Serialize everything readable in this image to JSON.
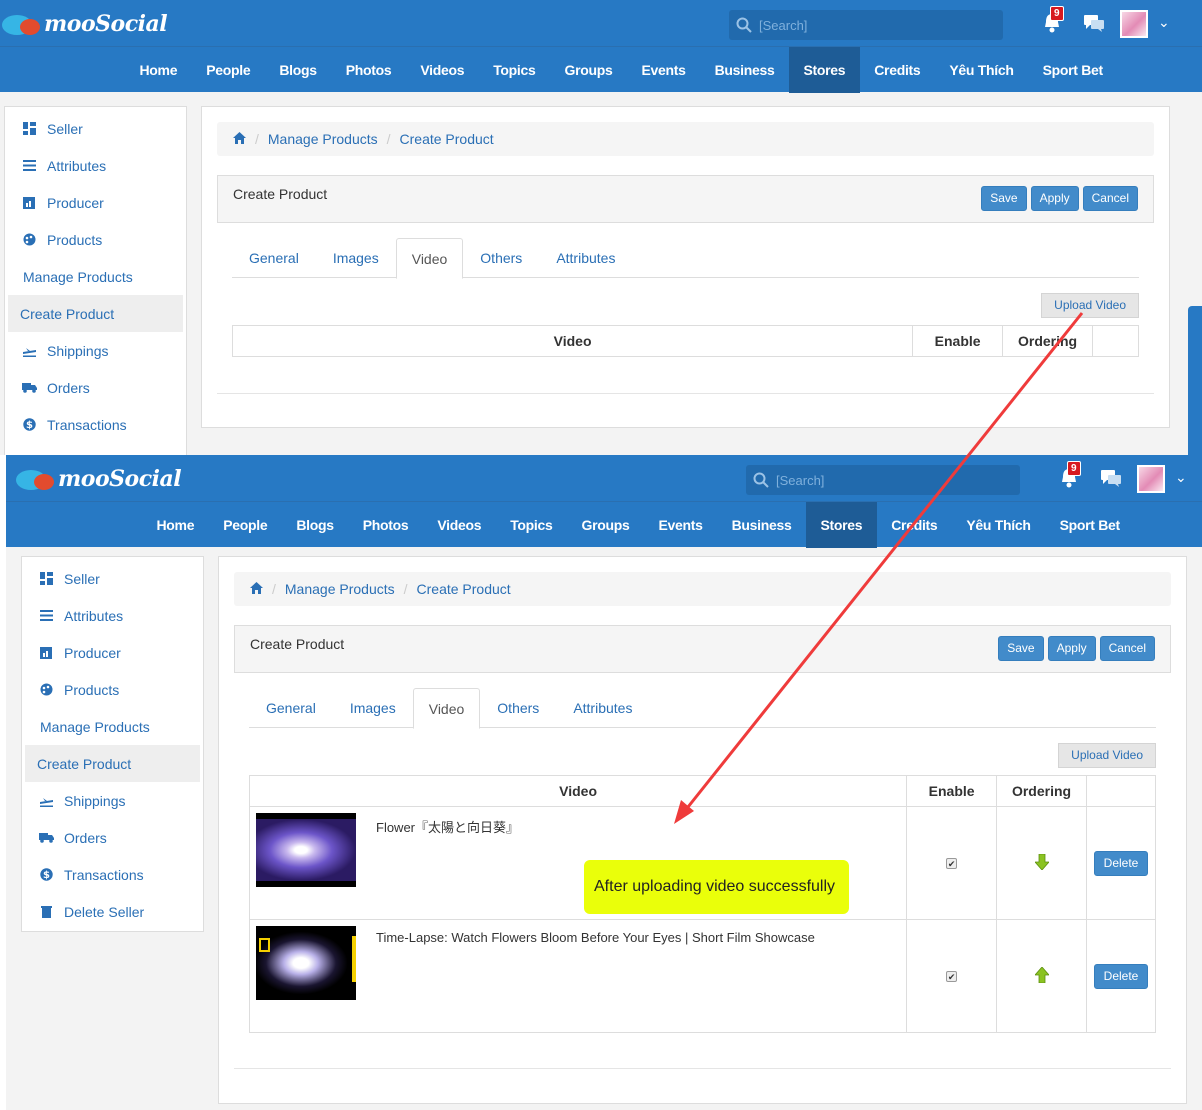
{
  "app": {
    "logo_text": "mooSocial",
    "search_placeholder": "[Search]",
    "notification_count": "9"
  },
  "nav": [
    "Home",
    "People",
    "Blogs",
    "Photos",
    "Videos",
    "Topics",
    "Groups",
    "Events",
    "Business",
    "Stores",
    "Credits",
    "Yêu Thích",
    "Sport Bet"
  ],
  "sidebar": {
    "seller": "Seller",
    "attributes": "Attributes",
    "producer": "Producer",
    "products": "Products",
    "manage_products": "Manage Products",
    "create_product": "Create Product",
    "shippings": "Shippings",
    "orders": "Orders",
    "transactions": "Transactions",
    "delete_seller": "Delete Seller"
  },
  "breadcrumb": {
    "manage": "Manage Products",
    "create": "Create Product"
  },
  "panel": {
    "title": "Create Product",
    "save": "Save",
    "apply": "Apply",
    "cancel": "Cancel"
  },
  "tabs": [
    "General",
    "Images",
    "Video",
    "Others",
    "Attributes"
  ],
  "upload_label": "Upload Video",
  "table": {
    "col_video": "Video",
    "col_enable": "Enable",
    "col_ordering": "Ordering",
    "rows": [
      {
        "title": "Flower『太陽と向日葵』",
        "enabled": true,
        "ordering": "down",
        "delete": "Delete"
      },
      {
        "title": "Time-Lapse: Watch Flowers Bloom Before Your Eyes | Short Film Showcase",
        "enabled": true,
        "ordering": "up",
        "delete": "Delete"
      }
    ]
  },
  "annotation": "After uploading video successfully",
  "colors": {
    "brand": "#2779c4",
    "button": "#428bca",
    "link": "#2a6fb5",
    "annotation_bg": "#eaff0a",
    "arrow": "#ef3b3b"
  }
}
